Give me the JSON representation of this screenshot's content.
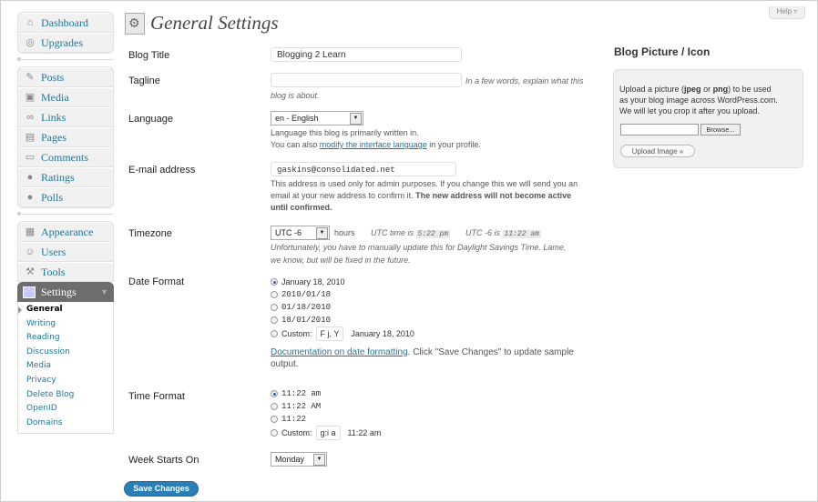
{
  "sidebar": {
    "group1": [
      {
        "label": "Dashboard",
        "icon": "home-icon"
      },
      {
        "label": "Upgrades",
        "icon": "upgrade-icon"
      }
    ],
    "group2": [
      {
        "label": "Posts",
        "icon": "pin-icon"
      },
      {
        "label": "Media",
        "icon": "media-icon"
      },
      {
        "label": "Links",
        "icon": "link-icon"
      },
      {
        "label": "Pages",
        "icon": "page-icon"
      },
      {
        "label": "Comments",
        "icon": "comment-icon"
      },
      {
        "label": "Ratings",
        "icon": "star-icon"
      },
      {
        "label": "Polls",
        "icon": "poll-icon"
      }
    ],
    "group3": [
      {
        "label": "Appearance",
        "icon": "appearance-icon"
      },
      {
        "label": "Users",
        "icon": "users-icon"
      },
      {
        "label": "Tools",
        "icon": "tools-icon"
      }
    ],
    "settings_label": "Settings",
    "submenu": [
      "General",
      "Writing",
      "Reading",
      "Discussion",
      "Media",
      "Privacy",
      "Delete Blog",
      "OpenID",
      "Domains"
    ]
  },
  "header": {
    "title": "General Settings",
    "help": "Help ▿"
  },
  "form": {
    "blog_title": {
      "label": "Blog Title",
      "value": "Blogging 2 Learn"
    },
    "tagline": {
      "label": "Tagline",
      "value": "",
      "hint1": "In a few words, explain what this",
      "hint2": "blog is about."
    },
    "language": {
      "label": "Language",
      "value": "en - English",
      "desc1": "Language this blog is primarily written in.",
      "desc2_pre": "You can also ",
      "desc2_link": "modify the interface language",
      "desc2_post": " in your profile."
    },
    "email": {
      "label": "E-mail address",
      "value": "gaskins@consolidated.net",
      "desc1": "This address is used only for admin purposes. If you change this we will send you an",
      "desc2_pre": "email at your new address to confirm it. ",
      "desc2_bold": "The new address will not become active",
      "desc3_bold": "until confirmed."
    },
    "timezone": {
      "label": "Timezone",
      "value": "UTC -6",
      "unit": "hours",
      "utc_label": "UTC time is",
      "utc_time": "5:22 pm",
      "local_label": "UTC -6 is",
      "local_time": "11:22 am",
      "note1": "Unfortunately, you have to manually update this for Daylight Savings Time. Lame,",
      "note2": "we know, but will be fixed in the future."
    },
    "date_format": {
      "label": "Date Format",
      "options": [
        "January 18, 2010",
        "2010/01/18",
        "01/18/2010",
        "18/01/2010"
      ],
      "custom_label": "Custom:",
      "custom_value": "F j, Y",
      "custom_preview": "January 18, 2010",
      "doc_link": "Documentation on date formatting",
      "doc_text": ". Click \"Save Changes\" to update sample",
      "doc_text2": "output."
    },
    "time_format": {
      "label": "Time Format",
      "options": [
        "11:22 am",
        "11:22 AM",
        "11:22"
      ],
      "custom_label": "Custom:",
      "custom_value": "g:i a",
      "custom_preview": "11:22 am"
    },
    "week_start": {
      "label": "Week Starts On",
      "value": "Monday"
    },
    "save_label": "Save Changes"
  },
  "blog_picture": {
    "title": "Blog Picture / Icon",
    "text_pre": "Upload a picture (",
    "jpeg": "jpeg",
    "text_or": " or ",
    "png": "png",
    "text_post": ") to be used",
    "line2": "as your blog image across WordPress.com.",
    "line3": "We will let you crop it after you upload.",
    "browse": "Browse...",
    "upload": "Upload Image »"
  }
}
